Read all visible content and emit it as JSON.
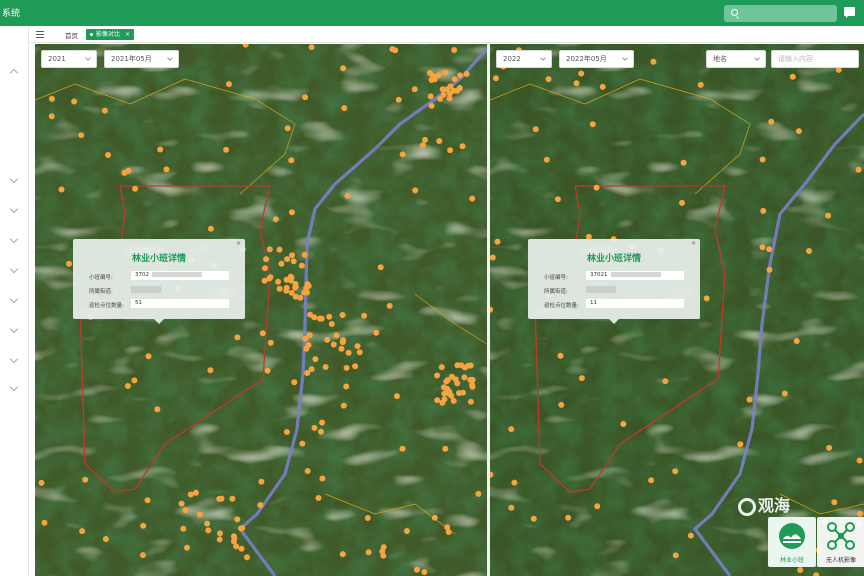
{
  "app": {
    "title": "系统"
  },
  "tabs": {
    "home": "首页",
    "active": "影像对比",
    "close": "×"
  },
  "left": {
    "year": "2021",
    "month": "2021年05月",
    "popup": {
      "title": "林业小班详情",
      "close": "×",
      "rows": [
        {
          "label": "小班编号:",
          "value": "3702"
        },
        {
          "label": "所属街道:",
          "value": ""
        },
        {
          "label": "巡检点位数量:",
          "value": "51"
        }
      ]
    }
  },
  "right": {
    "year": "2022",
    "month": "2022年05月",
    "place_label": "地名",
    "place_placeholder": "请输入内容",
    "popup": {
      "title": "林业小班详情",
      "close": "×",
      "rows": [
        {
          "label": "小班编号:",
          "value": "37021"
        },
        {
          "label": "所属街道:",
          "value": ""
        },
        {
          "label": "巡检点位数量:",
          "value": "11"
        }
      ]
    }
  },
  "layers": [
    {
      "label": "林业小班",
      "icon": "forest-globe-icon",
      "active": true
    },
    {
      "label": "无人机影像",
      "icon": "drone-icon",
      "active": false
    }
  ],
  "watermark": "观海",
  "colors": {
    "brand": "#1f9b58",
    "point": "#f7a340",
    "boundary": "#c0392b",
    "road": "#7a7fc8"
  }
}
